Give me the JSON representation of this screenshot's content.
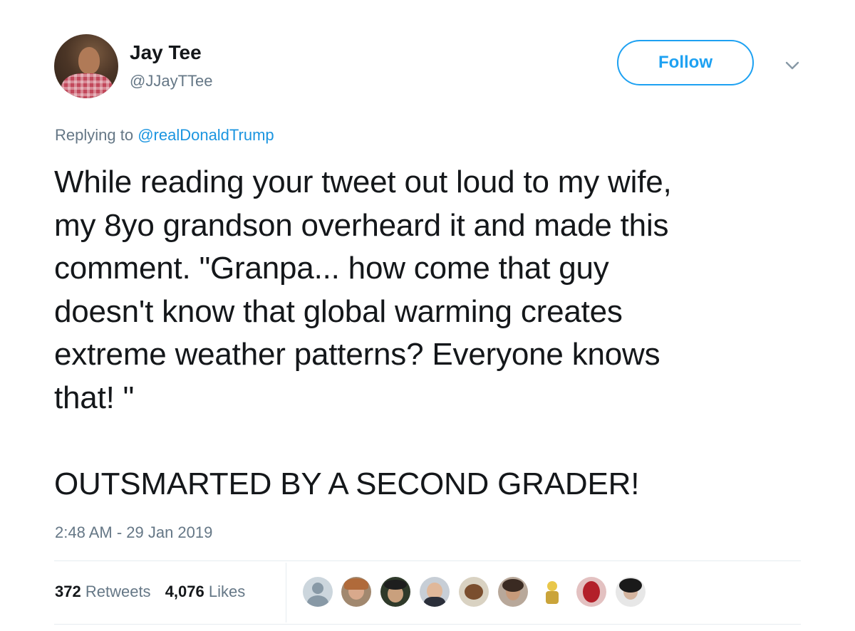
{
  "author": {
    "name": "Jay Tee",
    "handle": "@JJayTTee"
  },
  "follow_label": "Follow",
  "reply": {
    "prefix": "Replying to ",
    "mention": "@realDonaldTrump"
  },
  "tweet_text": "While reading your tweet out loud to my wife,\nmy 8yo grandson overheard it and made this\ncomment. \"Granpa... how come that guy\ndoesn't know that global warming creates\nextreme weather patterns? Everyone knows\nthat! \"\n\nOUTSMARTED BY A SECOND GRADER!",
  "timestamp": "2:48 AM - 29 Jan 2019",
  "stats": {
    "retweets_count": "372",
    "retweets_label": "Retweets",
    "likes_count": "4,076",
    "likes_label": "Likes"
  },
  "icons": {
    "menu": "chevron-down-icon",
    "avatar": "avatar-photo"
  },
  "colors": {
    "accent": "#1da1f2",
    "link": "#1b95e0",
    "secondary_text": "#657786",
    "primary_text": "#14171a",
    "divider": "#e6ecf0"
  }
}
